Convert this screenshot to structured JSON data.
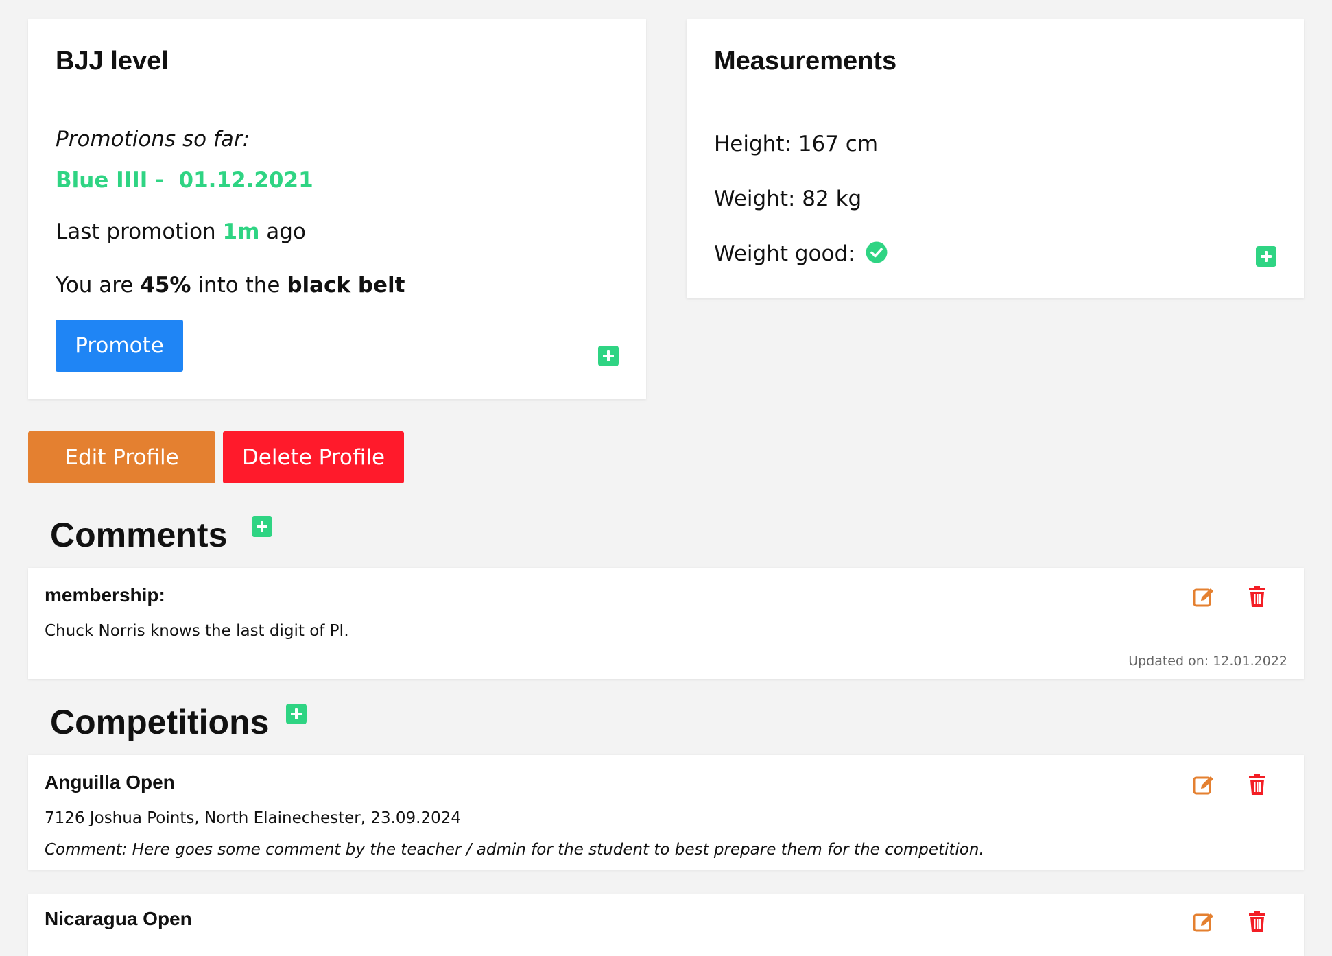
{
  "colors": {
    "accent_green": "#2fd483",
    "promote_blue": "#1f85f5",
    "edit_orange": "#e48030",
    "delete_red": "#ff1a2b",
    "edit_icon": "#e48030",
    "delete_icon": "#f31e25"
  },
  "bjj_card": {
    "title": "BJJ level",
    "promotions_label": "Promotions so far:",
    "promotion_entry": "Blue IIII -  01.12.2021",
    "last_promo_prefix": "Last promotion ",
    "last_promo_value": "1m",
    "last_promo_suffix": " ago",
    "progress_prefix": "You are ",
    "progress_value": "45%",
    "progress_middle": " into the ",
    "progress_target": "black belt",
    "promote_button": "Promote",
    "add_icon": "plus-square-icon"
  },
  "measurements_card": {
    "title": "Measurements",
    "height": "Height: 167 cm",
    "weight": "Weight: 82 kg",
    "weight_good_label": "Weight good:",
    "weight_good_icon": "check-circle-icon",
    "add_icon": "plus-square-icon"
  },
  "profile_actions": {
    "edit_label": "Edit Profile",
    "delete_label": "Delete Profile"
  },
  "comments": {
    "title": "Comments",
    "items": [
      {
        "title": "membership:",
        "text": "Chuck Norris knows the last digit of PI.",
        "updated": "Updated on: 12.01.2022"
      }
    ]
  },
  "competitions": {
    "title": "Competitions",
    "items": [
      {
        "title": "Anguilla Open",
        "details": "7126 Joshua Points, North Elainechester, 23.09.2024",
        "comment": "Comment: Here goes some comment by the teacher / admin for the student to best prepare them for the competition."
      },
      {
        "title": "Nicaragua Open"
      }
    ]
  }
}
